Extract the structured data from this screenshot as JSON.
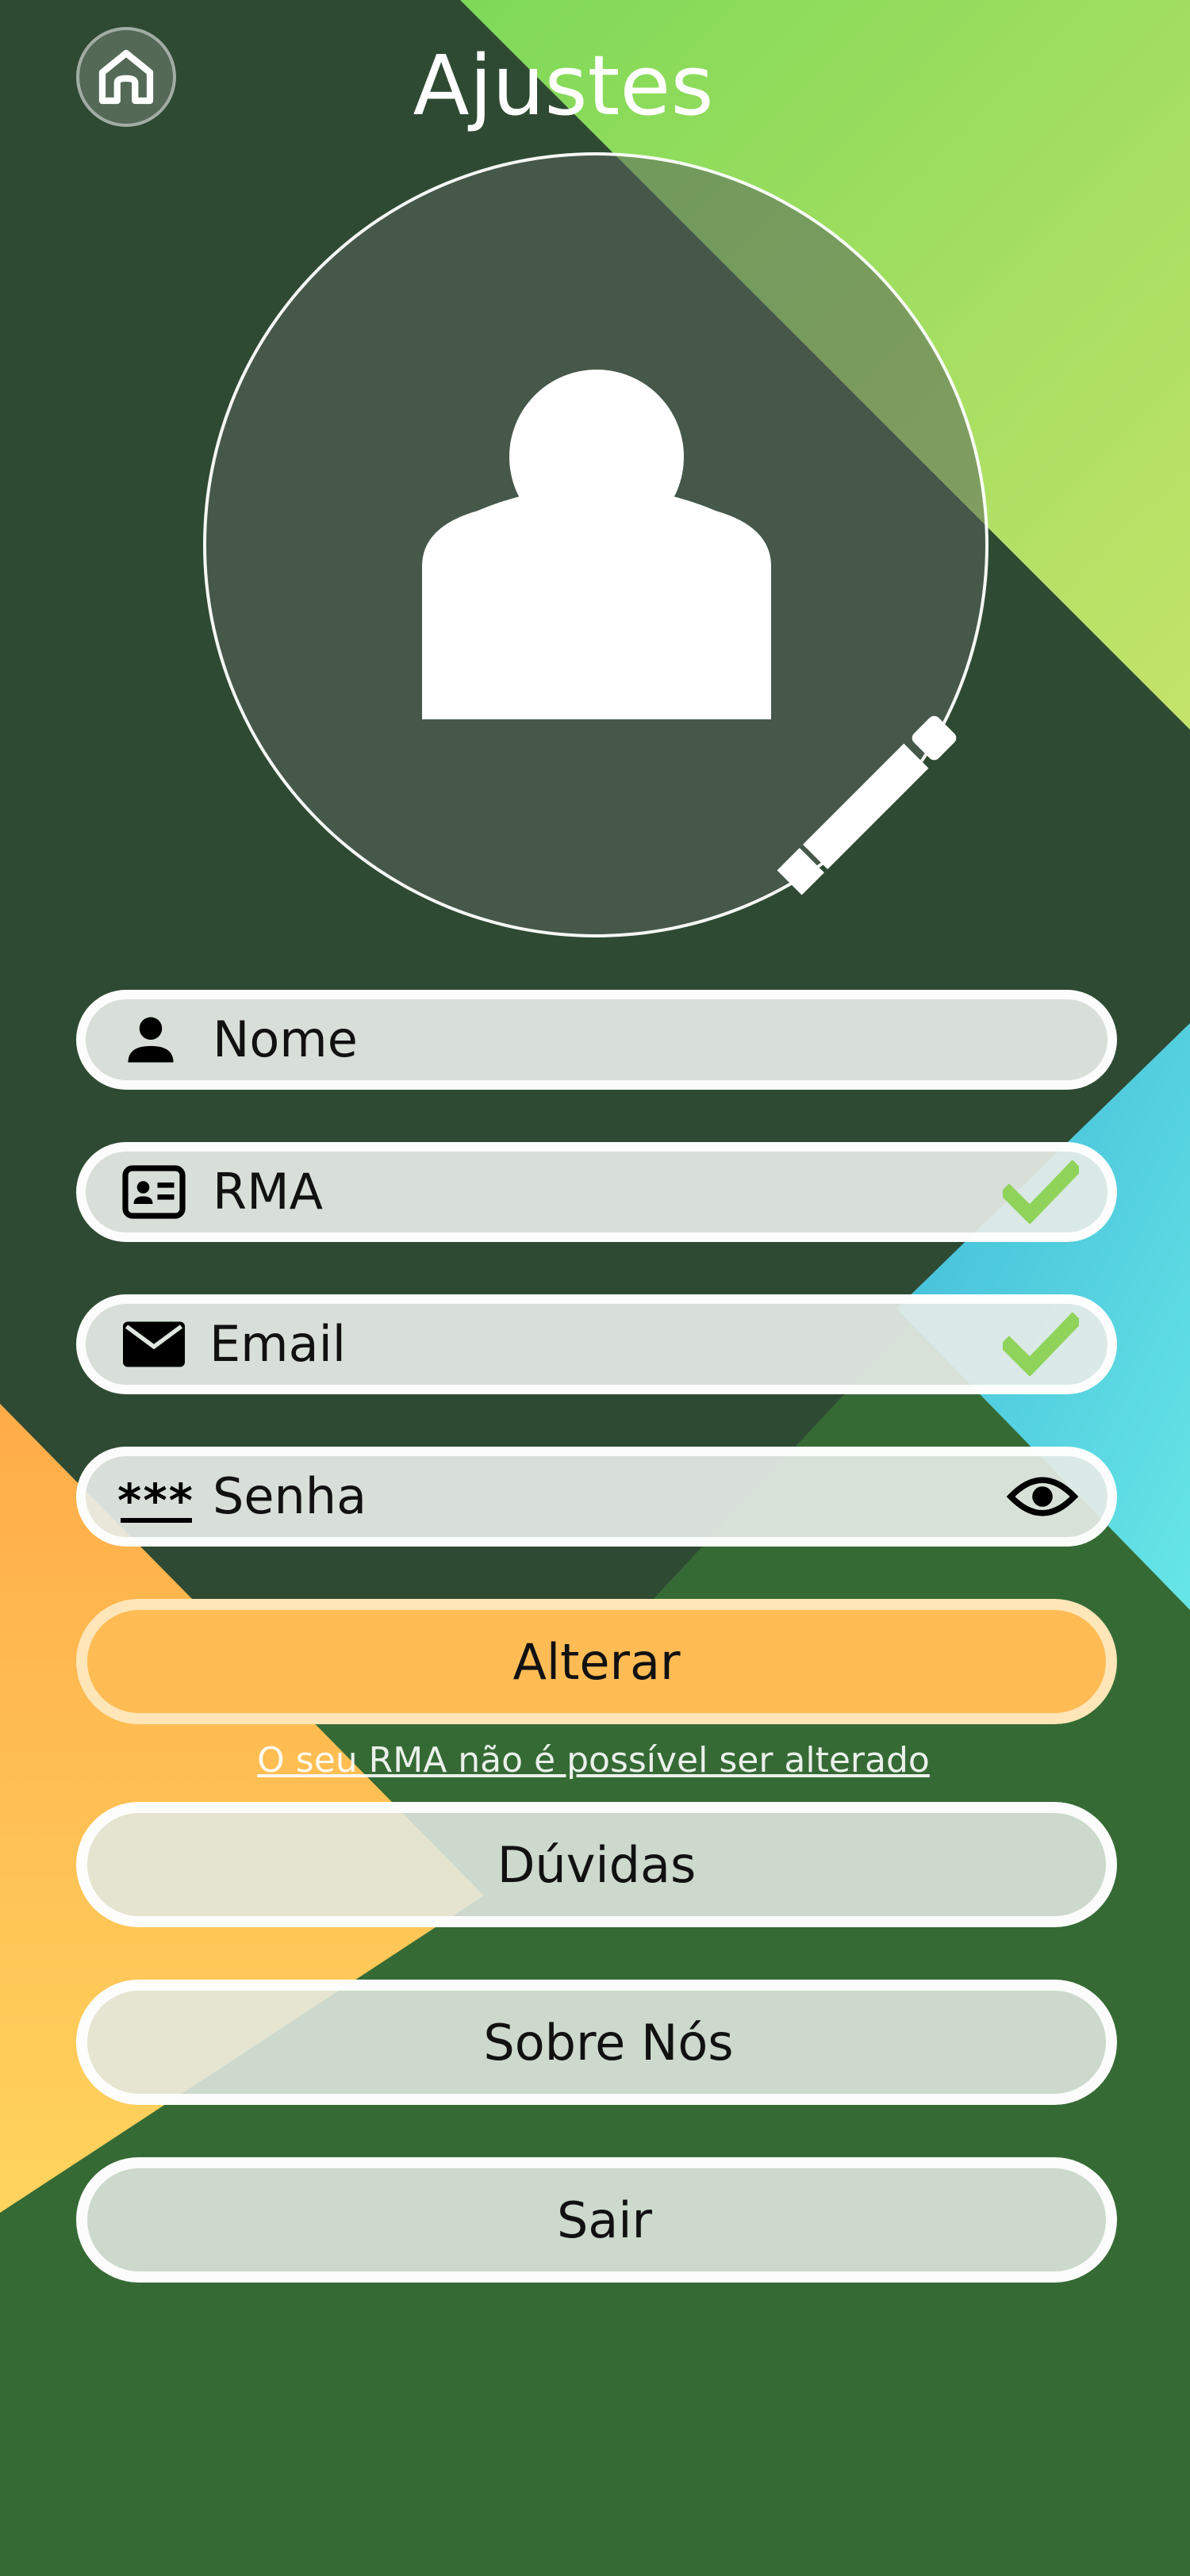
{
  "header": {
    "title": "Ajustes",
    "home_icon": "home-icon"
  },
  "profile": {
    "avatar_icon": "person-icon",
    "edit_icon": "pencil-icon"
  },
  "fields": {
    "nome": {
      "label": "Nome",
      "icon": "person-icon"
    },
    "rma": {
      "label": "RMA",
      "icon": "id-card-icon",
      "status_icon": "checkmark-icon"
    },
    "email": {
      "label": "Email",
      "icon": "envelope-icon",
      "status_icon": "checkmark-icon"
    },
    "senha": {
      "label": "Senha",
      "icon": "password-icon",
      "mask": "***",
      "action_icon": "eye-icon"
    }
  },
  "actions": {
    "alterar": "Alterar",
    "note": "O seu RMA não é possível ser alterado",
    "duvidas": "Dúvidas",
    "sobre": "Sobre Nós",
    "sair": "Sair"
  },
  "colors": {
    "dark_green": "#2f4a33",
    "mid_green": "#3a7a3a",
    "lime": "#8ed85a",
    "cyan": "#4dd6e2",
    "orange": "#ffb347",
    "check": "#8fd35a",
    "primary_button": "#ffbc55"
  }
}
